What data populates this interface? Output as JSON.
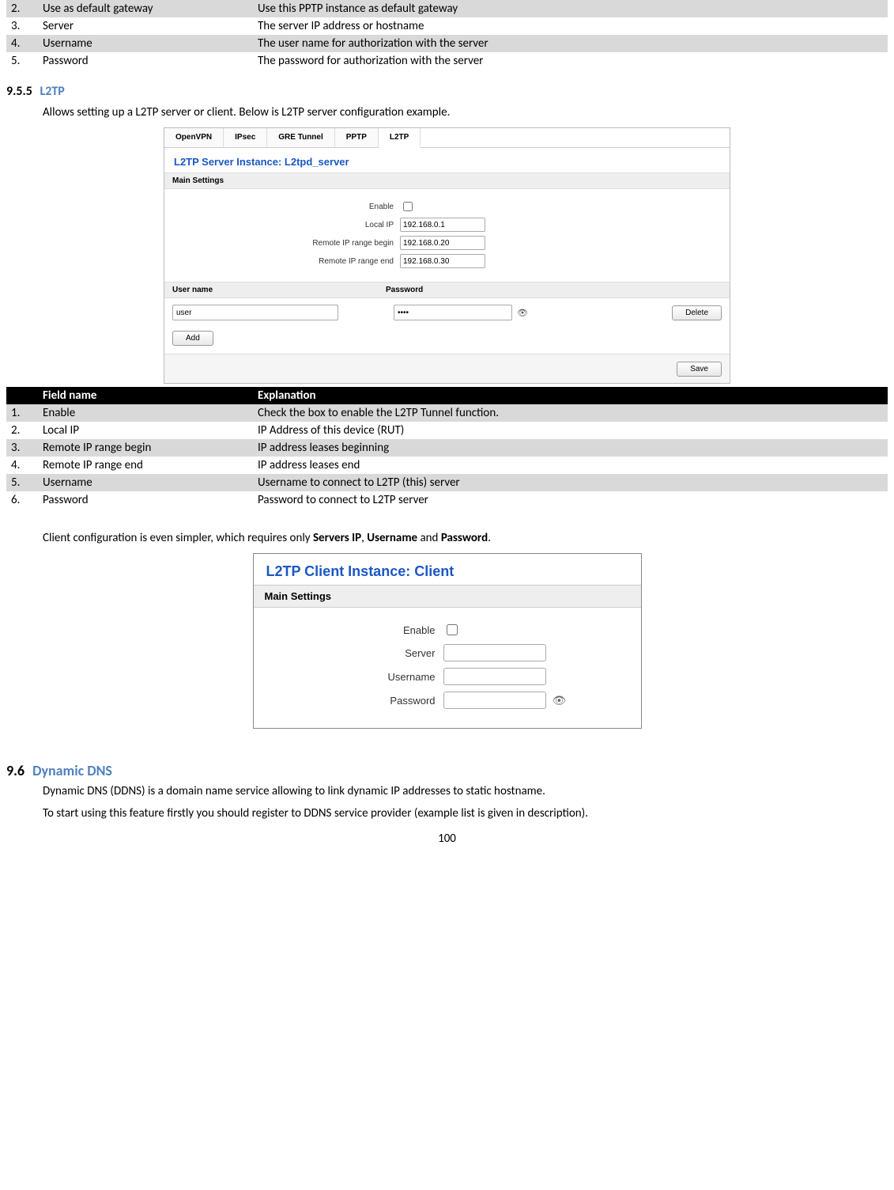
{
  "top_table": {
    "rows": [
      {
        "num": "2.",
        "field": "Use as default gateway",
        "exp": "Use this PPTP instance as default gateway"
      },
      {
        "num": "3.",
        "field": "Server",
        "exp": "The server IP address or hostname"
      },
      {
        "num": "4.",
        "field": "Username",
        "exp": "The user name for authorization with the server"
      },
      {
        "num": "5.",
        "field": "Password",
        "exp": "The password for authorization with the server"
      }
    ]
  },
  "sec_955": {
    "num": "9.5.5",
    "title": "L2TP",
    "intro": "Allows setting up a L2TP server or client.  Below is L2TP server configuration example."
  },
  "shot1": {
    "tabs": [
      "OpenVPN",
      "IPsec",
      "GRE Tunnel",
      "PPTP",
      "L2TP"
    ],
    "active_tab_index": 4,
    "instance_title": "L2TP Server Instance: L2tpd_server",
    "main_settings": "Main Settings",
    "fields": {
      "enable_label": "Enable",
      "local_ip_label": "Local IP",
      "local_ip_value": "192.168.0.1",
      "range_begin_label": "Remote IP range begin",
      "range_begin_value": "192.168.0.20",
      "range_end_label": "Remote IP range end",
      "range_end_value": "192.168.0.30"
    },
    "user_header": {
      "c1": "User name",
      "c2": "Password"
    },
    "user_row": {
      "user": "user",
      "pass_masked": "••••"
    },
    "delete_btn": "Delete",
    "add_btn": "Add",
    "save_btn": "Save"
  },
  "l2tp_table": {
    "head": {
      "c1": "",
      "c2": "Field name",
      "c3": "Explanation"
    },
    "rows": [
      {
        "num": "1.",
        "field": "Enable",
        "exp": "Check the box to enable the L2TP Tunnel function."
      },
      {
        "num": "2.",
        "field": "Local IP",
        "exp": "IP Address of this device (RUT)"
      },
      {
        "num": "3.",
        "field": "Remote IP range begin",
        "exp": "IP address leases beginning"
      },
      {
        "num": "4.",
        "field": "Remote IP range end",
        "exp": "IP address leases end"
      },
      {
        "num": "5.",
        "field": "Username",
        "exp": "Username to connect to L2TP (this) server"
      },
      {
        "num": "6.",
        "field": "Password",
        "exp": "Password to connect to L2TP server"
      }
    ]
  },
  "client_text": {
    "p1a": "Client configuration is even simpler, which requires only ",
    "b1": "Servers IP",
    "sep1": ", ",
    "b2": "Username",
    "sep2": " and ",
    "b3": "Password",
    "end": "."
  },
  "shot2": {
    "title": "L2TP Client Instance: Client",
    "sub": "Main Settings",
    "enable": "Enable",
    "server": "Server",
    "username": "Username",
    "password": "Password"
  },
  "sec_96": {
    "num": "9.6",
    "title": "Dynamic DNS",
    "p1": "Dynamic DNS (DDNS) is a domain name service allowing to link dynamic IP addresses to static hostname.",
    "p2": "To start using this feature firstly you should register to DDNS service provider (example list is given in description)."
  },
  "page_number": "100"
}
